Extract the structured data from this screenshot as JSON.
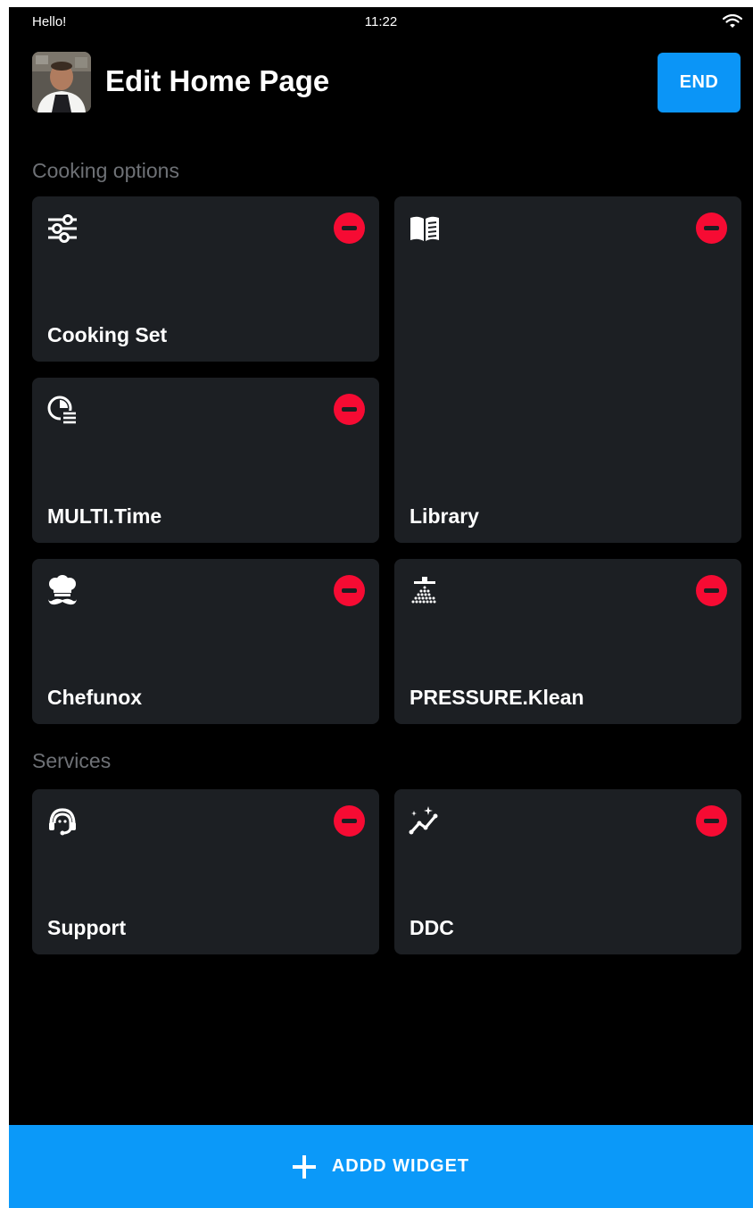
{
  "status_bar": {
    "greeting": "Hello!",
    "time": "11:22"
  },
  "header": {
    "title": "Edit Home Page",
    "end_label": "END"
  },
  "sections": {
    "cooking_options": {
      "title": "Cooking options",
      "cards": [
        {
          "label": "Cooking Set",
          "icon": "sliders-icon"
        },
        {
          "label": "Library",
          "icon": "book-icon"
        },
        {
          "label": "MULTI.Time",
          "icon": "multi-timer-icon"
        },
        {
          "label": "Chefunox",
          "icon": "chef-mustache-icon"
        },
        {
          "label": "PRESSURE.Klean",
          "icon": "shower-clean-icon"
        }
      ]
    },
    "services": {
      "title": "Services",
      "cards": [
        {
          "label": "Support",
          "icon": "headset-icon"
        },
        {
          "label": "DDC",
          "icon": "sparkle-chart-icon"
        }
      ]
    }
  },
  "footer": {
    "add_widget_label": "ADDD WIDGET"
  },
  "colors": {
    "accent_blue": "#0b95f7",
    "remove_red": "#f60b33",
    "card_bg": "#1c1f23",
    "section_label": "#6e7176"
  }
}
